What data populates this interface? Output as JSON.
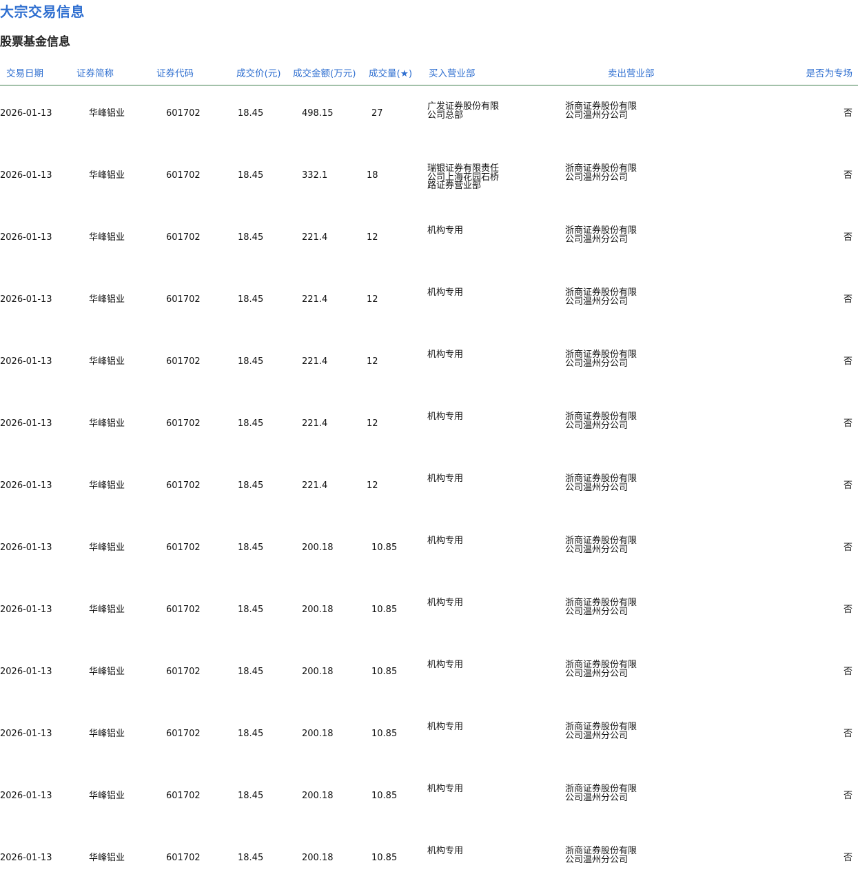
{
  "page": {
    "title": "大宗交易信息",
    "section_title": "股票基金信息"
  },
  "table": {
    "columns": [
      "交易日期",
      "证券简称",
      "证券代码",
      "成交价(元)",
      "成交金额(万元)",
      "成交量(★)",
      "买入营业部",
      "卖出营业部",
      "是否为专场"
    ],
    "rows": [
      {
        "date": "2026-01-13",
        "name": "华峰铝业",
        "code": "601702",
        "price": "18.45",
        "amount": "498.15",
        "volume": "27",
        "buyer": "广发证券股份有限公司总部",
        "seller": "浙商证券股份有限公司温州分公司",
        "special": "否"
      },
      {
        "date": "2026-01-13",
        "name": "华峰铝业",
        "code": "601702",
        "price": "18.45",
        "amount": "332.1",
        "volume": "18",
        "buyer": "瑞银证券有限责任公司上海花园石桥路证券营业部",
        "seller": "浙商证券股份有限公司温州分公司",
        "special": "否"
      },
      {
        "date": "2026-01-13",
        "name": "华峰铝业",
        "code": "601702",
        "price": "18.45",
        "amount": "221.4",
        "volume": "12",
        "buyer": "机构专用",
        "seller": "浙商证券股份有限公司温州分公司",
        "special": "否"
      },
      {
        "date": "2026-01-13",
        "name": "华峰铝业",
        "code": "601702",
        "price": "18.45",
        "amount": "221.4",
        "volume": "12",
        "buyer": "机构专用",
        "seller": "浙商证券股份有限公司温州分公司",
        "special": "否"
      },
      {
        "date": "2026-01-13",
        "name": "华峰铝业",
        "code": "601702",
        "price": "18.45",
        "amount": "221.4",
        "volume": "12",
        "buyer": "机构专用",
        "seller": "浙商证券股份有限公司温州分公司",
        "special": "否"
      },
      {
        "date": "2026-01-13",
        "name": "华峰铝业",
        "code": "601702",
        "price": "18.45",
        "amount": "221.4",
        "volume": "12",
        "buyer": "机构专用",
        "seller": "浙商证券股份有限公司温州分公司",
        "special": "否"
      },
      {
        "date": "2026-01-13",
        "name": "华峰铝业",
        "code": "601702",
        "price": "18.45",
        "amount": "221.4",
        "volume": "12",
        "buyer": "机构专用",
        "seller": "浙商证券股份有限公司温州分公司",
        "special": "否"
      },
      {
        "date": "2026-01-13",
        "name": "华峰铝业",
        "code": "601702",
        "price": "18.45",
        "amount": "200.18",
        "volume": "10.85",
        "buyer": "机构专用",
        "seller": "浙商证券股份有限公司温州分公司",
        "special": "否"
      },
      {
        "date": "2026-01-13",
        "name": "华峰铝业",
        "code": "601702",
        "price": "18.45",
        "amount": "200.18",
        "volume": "10.85",
        "buyer": "机构专用",
        "seller": "浙商证券股份有限公司温州分公司",
        "special": "否"
      },
      {
        "date": "2026-01-13",
        "name": "华峰铝业",
        "code": "601702",
        "price": "18.45",
        "amount": "200.18",
        "volume": "10.85",
        "buyer": "机构专用",
        "seller": "浙商证券股份有限公司温州分公司",
        "special": "否"
      },
      {
        "date": "2026-01-13",
        "name": "华峰铝业",
        "code": "601702",
        "price": "18.45",
        "amount": "200.18",
        "volume": "10.85",
        "buyer": "机构专用",
        "seller": "浙商证券股份有限公司温州分公司",
        "special": "否"
      },
      {
        "date": "2026-01-13",
        "name": "华峰铝业",
        "code": "601702",
        "price": "18.45",
        "amount": "200.18",
        "volume": "10.85",
        "buyer": "机构专用",
        "seller": "浙商证券股份有限公司温州分公司",
        "special": "否"
      },
      {
        "date": "2026-01-13",
        "name": "华峰铝业",
        "code": "601702",
        "price": "18.45",
        "amount": "200.18",
        "volume": "10.85",
        "buyer": "机构专用",
        "seller": "浙商证券股份有限公司温州分公司",
        "special": "否"
      }
    ]
  },
  "colors": {
    "title": "#2f6fd0",
    "header_text": "#2f6fd0",
    "header_rule": "#3a7a4a"
  }
}
